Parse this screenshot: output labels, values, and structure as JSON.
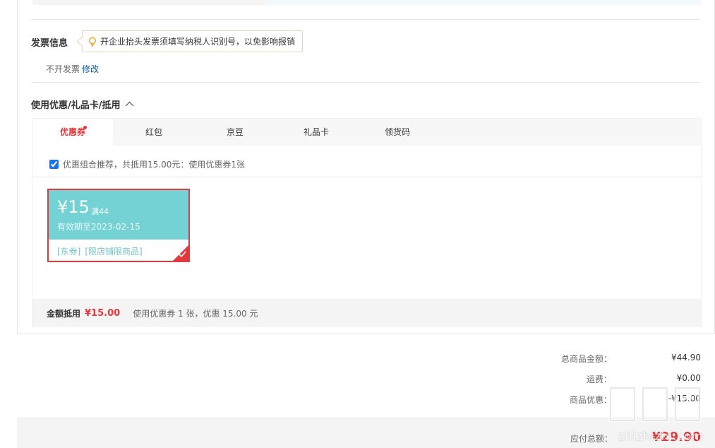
{
  "invoice": {
    "title": "发票信息",
    "tip": "开企业抬头发票须填写纳税人识别号，以免影响报销",
    "status": "不开发票",
    "edit_label": "修改"
  },
  "discount": {
    "section_title": "使用优惠/礼品卡/抵用",
    "tabs": [
      {
        "label": "优惠券"
      },
      {
        "label": "红包"
      },
      {
        "label": "京豆"
      },
      {
        "label": "礼品卡"
      },
      {
        "label": "领货码"
      }
    ],
    "active_tab": "优惠券",
    "recommend_checked": true,
    "recommend_text": "优惠组合推荐，共抵用15.00元：使用优惠券1张",
    "coupon": {
      "amount": "¥15",
      "condition": "满44",
      "expiry": "有效期至2023-02-15",
      "tags": [
        "[东券]",
        "[限店铺限商品]"
      ],
      "selected": true
    },
    "summary": {
      "label": "金额抵用",
      "amount": "¥15.00",
      "desc": "使用优惠券 1 张，优惠 15.00 元"
    }
  },
  "totals": {
    "items_label": "总商品金额：",
    "items_value": "¥44.90",
    "shipping_label": "运费：",
    "shipping_value": "¥0.00",
    "discount_label": "商品优惠：",
    "discount_value": "-¥15.00",
    "pay_label": "应付总额：",
    "pay_value": "¥29.90"
  },
  "watermark": {
    "text": "zhizhizhi.com",
    "icon": "zhi-logo-icon"
  },
  "colors": {
    "accent": "#e4393c",
    "coupon": "#74d2d4",
    "link": "#005aa0"
  }
}
